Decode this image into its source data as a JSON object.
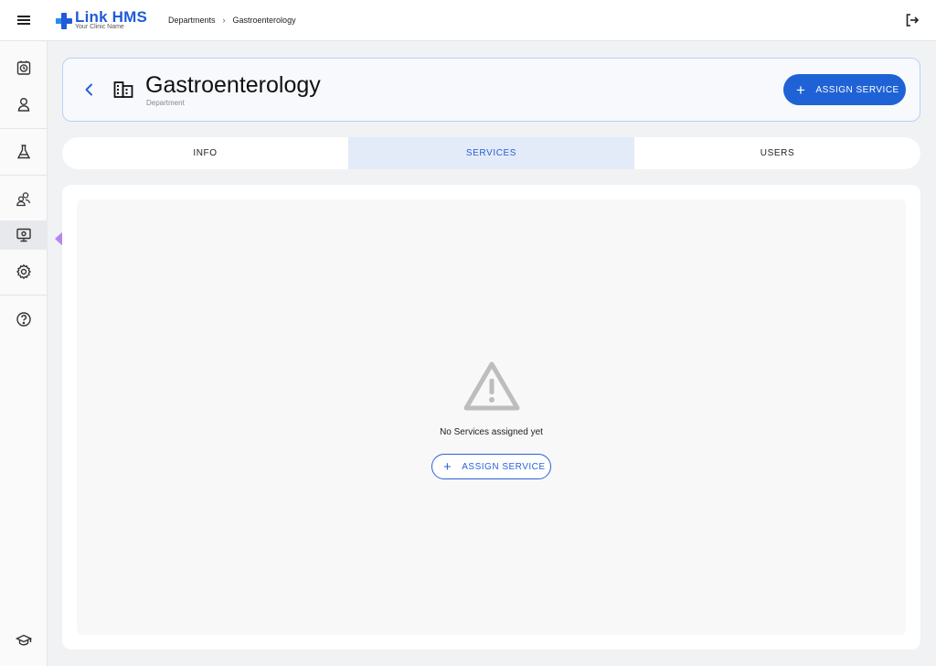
{
  "brand": {
    "name": "Link HMS",
    "tagline": "Your Clinic Name",
    "color": "#1f5bd8"
  },
  "breadcrumb": {
    "items": [
      "Departments",
      "Gastroenterology"
    ],
    "separator": "›"
  },
  "sidebar": {
    "items": [
      {
        "icon": "clock-icon"
      },
      {
        "icon": "person-icon"
      },
      {
        "icon": "flask-icon"
      },
      {
        "icon": "group-icon"
      },
      {
        "icon": "monitor-icon",
        "active": true
      },
      {
        "icon": "gear-icon"
      },
      {
        "icon": "help-icon"
      },
      {
        "icon": "graduation-cap-icon"
      }
    ]
  },
  "header": {
    "title": "Gastroenterology",
    "subtitle": "Department",
    "assign_button": {
      "plus": "+",
      "label": "ASSIGN SERVICE"
    }
  },
  "tabs": [
    {
      "label": "INFO"
    },
    {
      "label": "SERVICES",
      "active": true
    },
    {
      "label": "USERS"
    }
  ],
  "empty_state": {
    "message": "No Services assigned yet",
    "button": {
      "plus": "+",
      "label": "ASSIGN SERVICE"
    }
  },
  "colors": {
    "accent": "#1f62d6",
    "tab_active_bg": "#e3ebf8",
    "arrow": "#b785f3"
  }
}
